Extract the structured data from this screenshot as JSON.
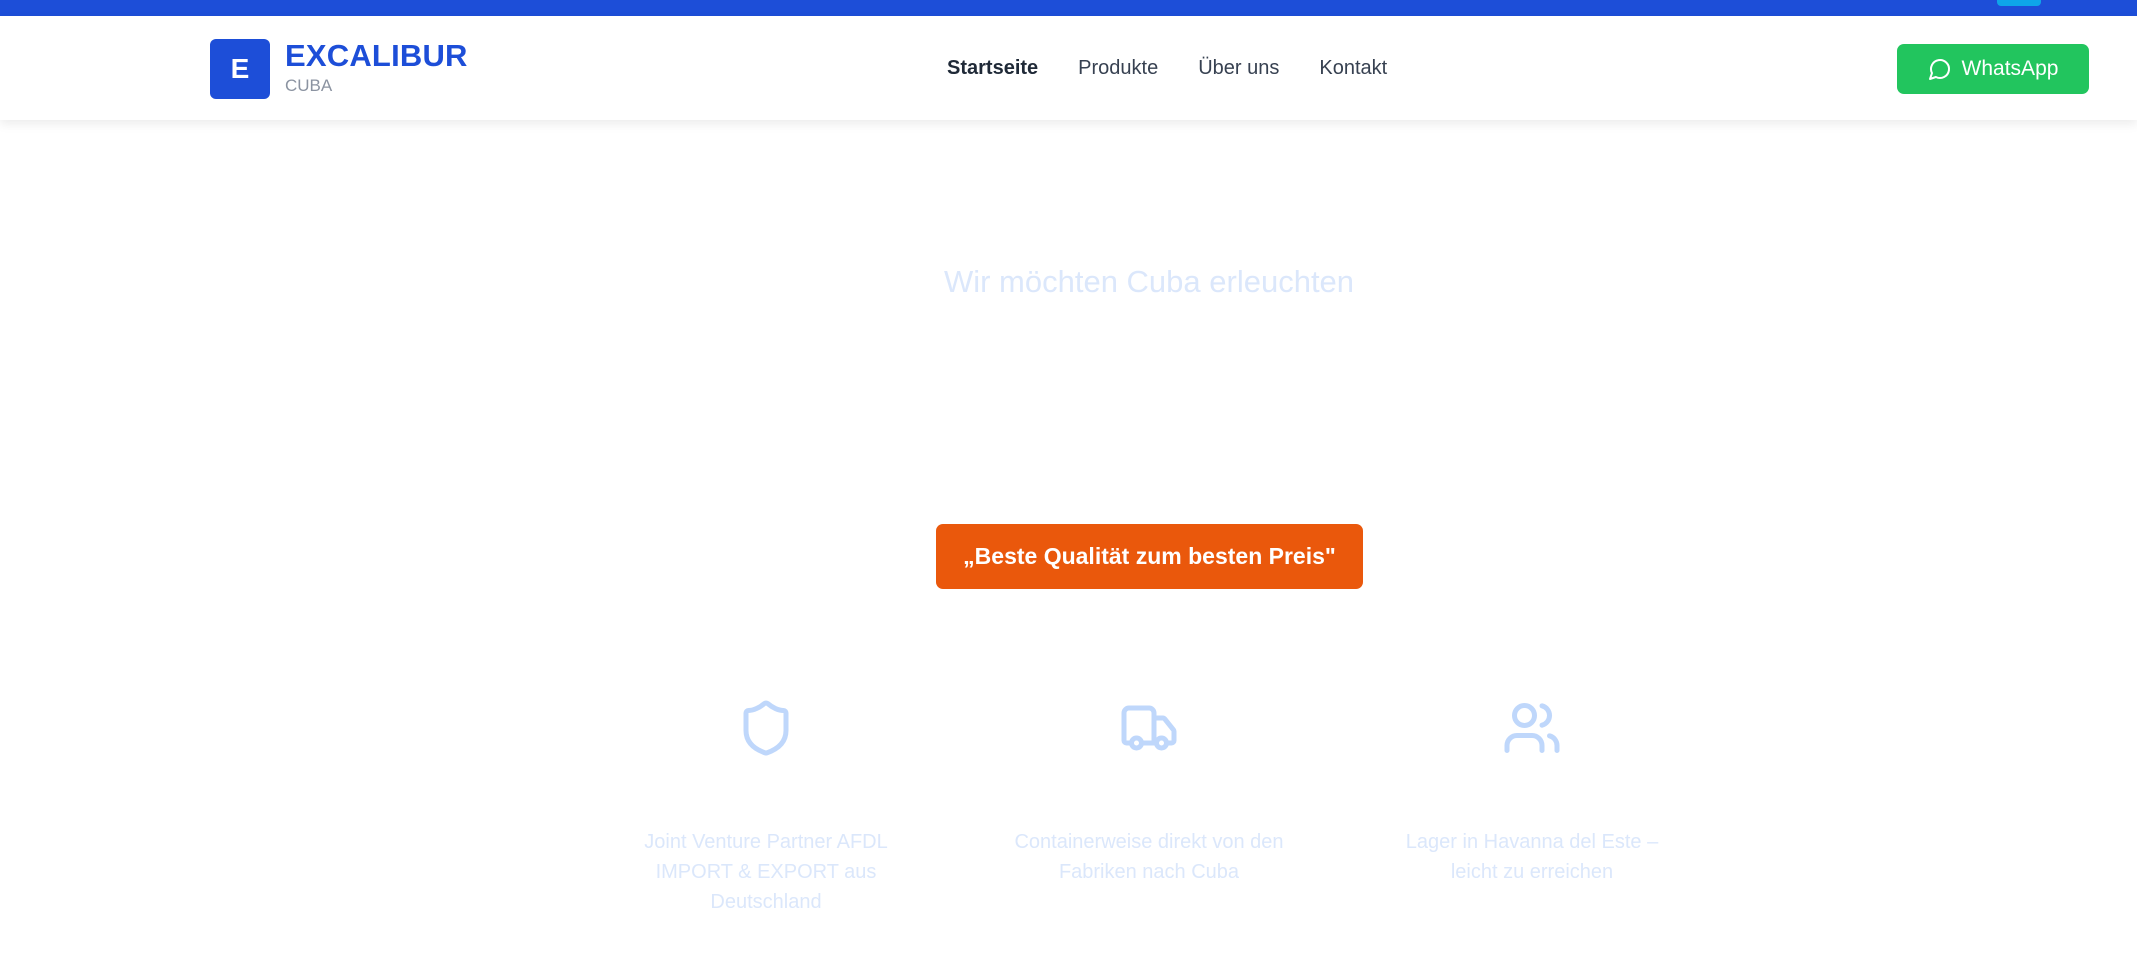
{
  "header": {
    "logo_letter": "E",
    "brand_name": "EXCALIBUR",
    "brand_sub": "CUBA",
    "nav": [
      {
        "label": "Startseite",
        "active": true
      },
      {
        "label": "Produkte",
        "active": false
      },
      {
        "label": "Über uns",
        "active": false
      },
      {
        "label": "Kontakt",
        "active": false
      }
    ],
    "whatsapp_label": "WhatsApp",
    "whatsapp_icon": "chat-bubble-icon"
  },
  "hero": {
    "title": "Wir möchten Cuba erleuchten",
    "cta_label": "„Beste Qualität zum besten Preis\""
  },
  "features": [
    {
      "icon": "shield-icon",
      "text": "Joint Venture Partner AFDL IMPORT & EXPORT aus Deutschland"
    },
    {
      "icon": "truck-icon",
      "text": "Containerweise direkt von den Fabriken nach Cuba"
    },
    {
      "icon": "users-icon",
      "text": "Lager in Havanna del Este – leicht zu erreichen"
    }
  ],
  "colors": {
    "primary": "#1d4ed8",
    "whatsapp": "#22c55e",
    "cta": "#ea580c",
    "faded_text": "#dbe7fb",
    "faded_icon": "#bfd7fb"
  }
}
